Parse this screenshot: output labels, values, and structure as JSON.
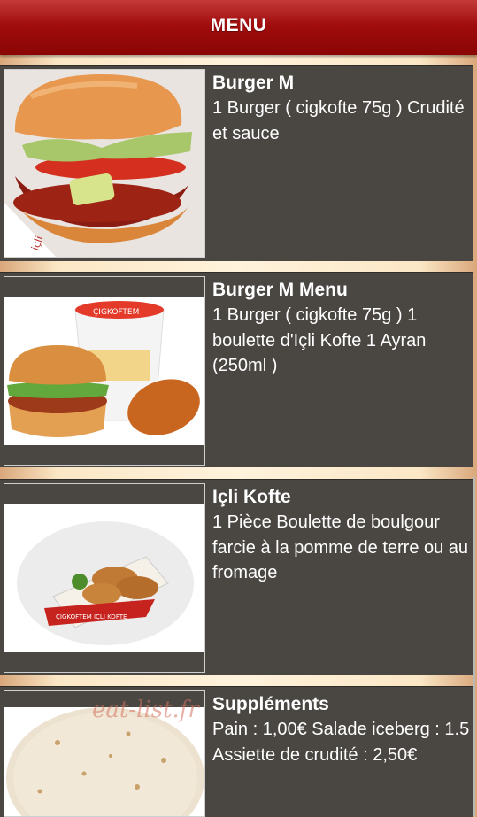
{
  "header": {
    "title": "MENU"
  },
  "items": [
    {
      "title": "Burger M",
      "description": "1 Burger ( cigkofte 75g ) Crudité et sauce",
      "image_icon": "burger-photo"
    },
    {
      "title": "Burger M Menu",
      "description": "1 Burger ( cigkofte 75g ) 1 boulette d'Içli Kofte 1 Ayran (250ml )",
      "image_icon": "burger-menu-photo"
    },
    {
      "title": "Içli Kofte",
      "description": "1 Pièce Boulette de boulgour farcie à la pomme de terre ou au fromage",
      "image_icon": "icli-kofte-photo"
    },
    {
      "title": "Suppléments",
      "description": "Pain : 1,00€ Salade iceberg : 1.5 Assiette de crudité : 2,50€",
      "image_icon": "flatbread-photo"
    }
  ],
  "watermark": "eat-list.fr",
  "colors": {
    "header": "#a10d0d",
    "card": "#4a4743",
    "background": "#fbe7c6"
  }
}
